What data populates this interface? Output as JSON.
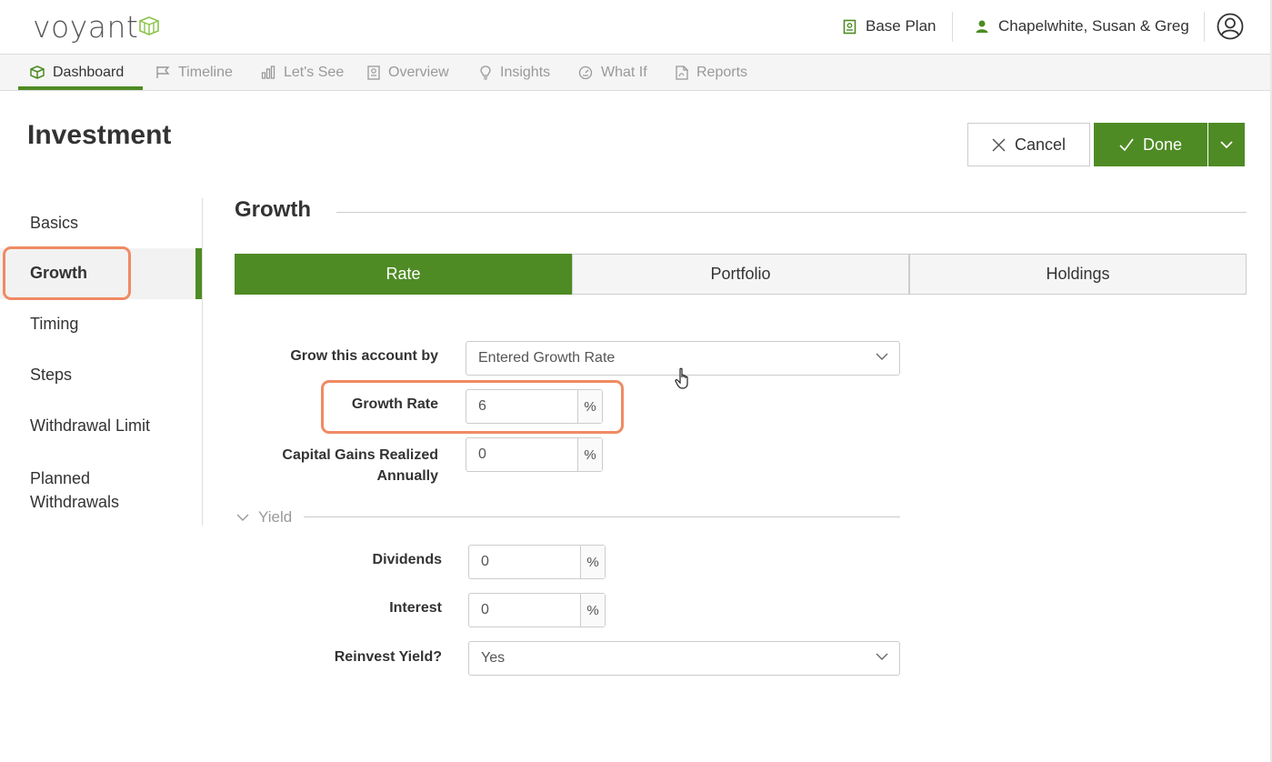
{
  "header": {
    "logo": "voyant",
    "plan": "Base Plan",
    "client": "Chapelwhite, Susan & Greg"
  },
  "nav": {
    "items": [
      {
        "label": "Dashboard",
        "icon": "cube-icon"
      },
      {
        "label": "Timeline",
        "icon": "flag-icon"
      },
      {
        "label": "Let's See",
        "icon": "bar-chart-icon"
      },
      {
        "label": "Overview",
        "icon": "report-icon"
      },
      {
        "label": "Insights",
        "icon": "lightbulb-icon"
      },
      {
        "label": "What If",
        "icon": "gauge-icon"
      },
      {
        "label": "Reports",
        "icon": "pdf-icon"
      }
    ],
    "active": "Dashboard"
  },
  "page": {
    "title": "Investment",
    "cancel_label": "Cancel",
    "done_label": "Done"
  },
  "side_menu": {
    "items": [
      "Basics",
      "Growth",
      "Timing",
      "Steps",
      "Withdrawal Limit",
      "Planned Withdrawals"
    ],
    "active": "Growth"
  },
  "section": {
    "title": "Growth",
    "tabs": [
      "Rate",
      "Portfolio",
      "Holdings"
    ],
    "active_tab": "Rate"
  },
  "form": {
    "grow_by_label": "Grow this account by",
    "grow_by_value": "Entered Growth Rate",
    "growth_rate_label": "Growth Rate",
    "growth_rate_value": "6",
    "capital_gains_label_1": "Capital Gains Realized",
    "capital_gains_label_2": "Annually",
    "capital_gains_value": "0",
    "percent_unit": "%",
    "yield_label": "Yield",
    "dividends_label": "Dividends",
    "dividends_value": "0",
    "interest_label": "Interest",
    "interest_value": "0",
    "reinvest_label": "Reinvest Yield?",
    "reinvest_value": "Yes"
  },
  "colors": {
    "brand_green": "#4e8b24",
    "highlight": "#f08a63"
  }
}
